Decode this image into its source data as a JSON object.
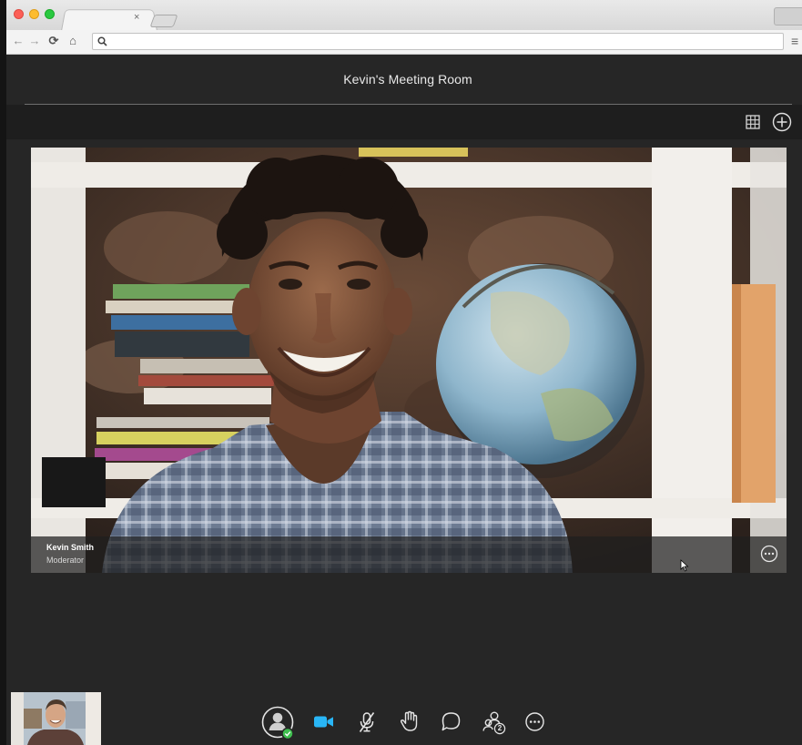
{
  "browser": {
    "tab_close": "×",
    "nav": {
      "back": "←",
      "forward": "→",
      "reload": "⟳",
      "home": "⌂"
    },
    "menu": "≡",
    "address_value": ""
  },
  "header": {
    "room_title": "Kevin's Meeting Room"
  },
  "header_actions": [
    {
      "name": "grid-view-icon"
    },
    {
      "name": "add-icon"
    }
  ],
  "video": {
    "participant_name": "Kevin Smith",
    "participant_role": "Moderator"
  },
  "controls": [
    {
      "name": "my-status-button",
      "icon": "avatar-icon",
      "status": "online"
    },
    {
      "name": "camera-button",
      "icon": "video-camera-icon",
      "active": true
    },
    {
      "name": "microphone-button",
      "icon": "microphone-muted-icon"
    },
    {
      "name": "raise-hand-button",
      "icon": "hand-icon"
    },
    {
      "name": "chat-button",
      "icon": "chat-bubble-icon"
    },
    {
      "name": "participants-button",
      "icon": "participants-icon",
      "count": "2"
    },
    {
      "name": "more-options-button",
      "icon": "ellipsis-icon"
    }
  ],
  "colors": {
    "background": "#262626",
    "accent": "#29b6f6",
    "status_online": "#3fbf4f",
    "text": "#e8e8e8"
  }
}
